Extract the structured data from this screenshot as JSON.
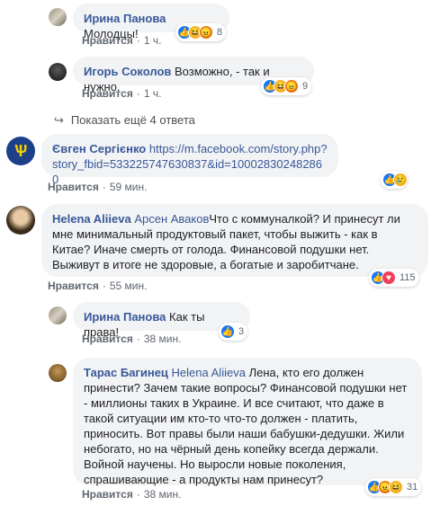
{
  "like_label": "Нравится",
  "comments": [
    {
      "author": "Ирина Панова",
      "text": "Молодцы!",
      "time": "1 ч.",
      "reactions": "8"
    },
    {
      "author": "Игорь Соколов",
      "text": "Возможно, - так и нужно.",
      "time": "1 ч.",
      "reactions": "9"
    },
    {
      "show_more": "Показать ещё 4 ответа"
    },
    {
      "author": "Євген Сергієнко",
      "link": "https://m.facebook.com/story.php?story_fbid=533225747630837&id=100028302482860",
      "time": "59 мин."
    },
    {
      "author": "Helena Aliieva",
      "mention": "Арсен Аваков",
      "text": "Что с коммуналкой? И принесут ли мне минимальный продуктовый пакет, чтобы выжить - как в Китае? Иначе смерть от голода. Финансовой подушки нет. Выживут в итоге не здоровые, а богатые и заробитчане.",
      "time": "55 мин.",
      "reactions": "115"
    },
    {
      "author": "Ирина Панова",
      "text": "Как ты права!",
      "time": "38 мин.",
      "reactions": "3"
    },
    {
      "author": "Тарас Багинец",
      "mention": "Helena Aliieva",
      "text": "Лена, кто его должен принести? Зачем такие вопросы? Финансовой подушки нет - миллионы таких в Украине. И все считают, что даже в такой ситуации им кто-то что-то должен - платить, приносить. Вот правы были наши бабушки-дедушки. Жили небогато, но на чёрный день копейку всегда держали. Войной научены. Но выросли новые поколения, спрашивающие - а продукты нам принесут?",
      "time": "38 мин.",
      "reactions": "31"
    }
  ]
}
